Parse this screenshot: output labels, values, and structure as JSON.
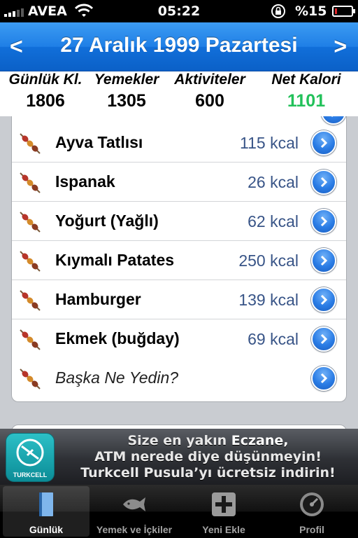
{
  "status_bar": {
    "carrier": "AVEA",
    "time": "05:22",
    "battery_text": "%15",
    "battery_level": 0.15
  },
  "nav": {
    "prev_label": "<",
    "title": "27 Aralık 1999 Pazartesi",
    "next_label": ">"
  },
  "summary": {
    "daily_label": "Günlük Kl.",
    "daily_value": "1806",
    "meals_label": "Yemekler",
    "meals_value": "1305",
    "activities_label": "Aktiviteler",
    "activities_value": "600",
    "net_label": "Net Kalori",
    "net_value": "1101",
    "net_color": "#22c15a"
  },
  "foods": [
    {
      "name": "Ayva Tatlısı",
      "kcal": "115 kcal",
      "icon": "food-skewer-icon"
    },
    {
      "name": "Ispanak",
      "kcal": "26 kcal",
      "icon": "food-skewer-icon"
    },
    {
      "name": "Yoğurt (Yağlı)",
      "kcal": "62 kcal",
      "icon": "food-skewer-icon"
    },
    {
      "name": "Kıymalı Patates",
      "kcal": "250 kcal",
      "icon": "food-skewer-icon"
    },
    {
      "name": "Hamburger",
      "kcal": "139 kcal",
      "icon": "food-skewer-icon"
    },
    {
      "name": "Ekmek (buğday)",
      "kcal": "69 kcal",
      "icon": "food-skewer-icon"
    }
  ],
  "add_prompt": "Başka Ne Yedin?",
  "ad": {
    "logo_text": "TURKCELL",
    "line1_pre": "Size en yakın ",
    "line1_highlight": "Eczane,",
    "line2": "ATM nerede diye düşünmeyin!",
    "line3": "Turkcell Pusula’yı ücretsiz indirin!"
  },
  "tabs": [
    {
      "label": "Günlük",
      "icon": "book-icon",
      "active": true
    },
    {
      "label": "Yemek ve İçkiler",
      "icon": "fish-icon",
      "active": false
    },
    {
      "label": "Yeni Ekle",
      "icon": "plus-icon",
      "active": false
    },
    {
      "label": "Profil",
      "icon": "speedometer-icon",
      "active": false
    }
  ],
  "colors": {
    "nav_blue": "#1f7fe6",
    "kcal_text": "#385487",
    "disclosure_blue": "#2a7ce5"
  }
}
